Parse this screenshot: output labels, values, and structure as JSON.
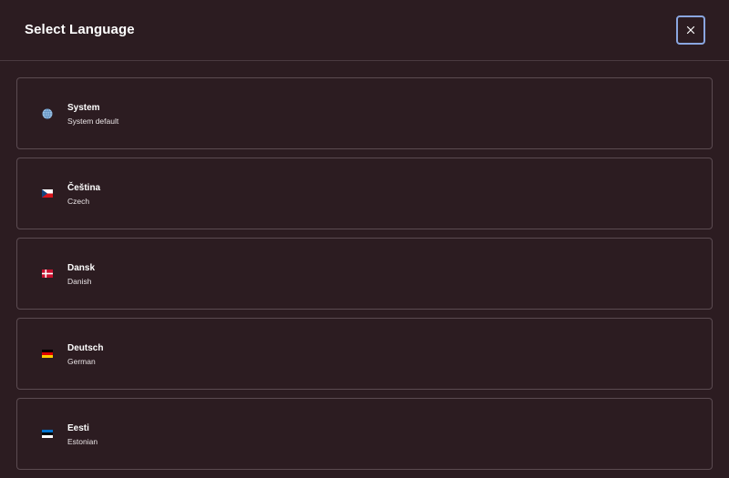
{
  "dialog": {
    "title": "Select Language",
    "close_icon": "close-icon"
  },
  "languages": [
    {
      "name": "System",
      "subtitle": "System default",
      "icon": "globe-icon"
    },
    {
      "name": "Čeština",
      "subtitle": "Czech",
      "icon": "czech-flag-icon"
    },
    {
      "name": "Dansk",
      "subtitle": "Danish",
      "icon": "danish-flag-icon"
    },
    {
      "name": "Deutsch",
      "subtitle": "German",
      "icon": "german-flag-icon"
    },
    {
      "name": "Eesti",
      "subtitle": "Estonian",
      "icon": "estonian-flag-icon"
    }
  ],
  "colors": {
    "background": "#2c1c21",
    "border": "#5b4b51",
    "focus_ring": "#8aa6e0"
  }
}
